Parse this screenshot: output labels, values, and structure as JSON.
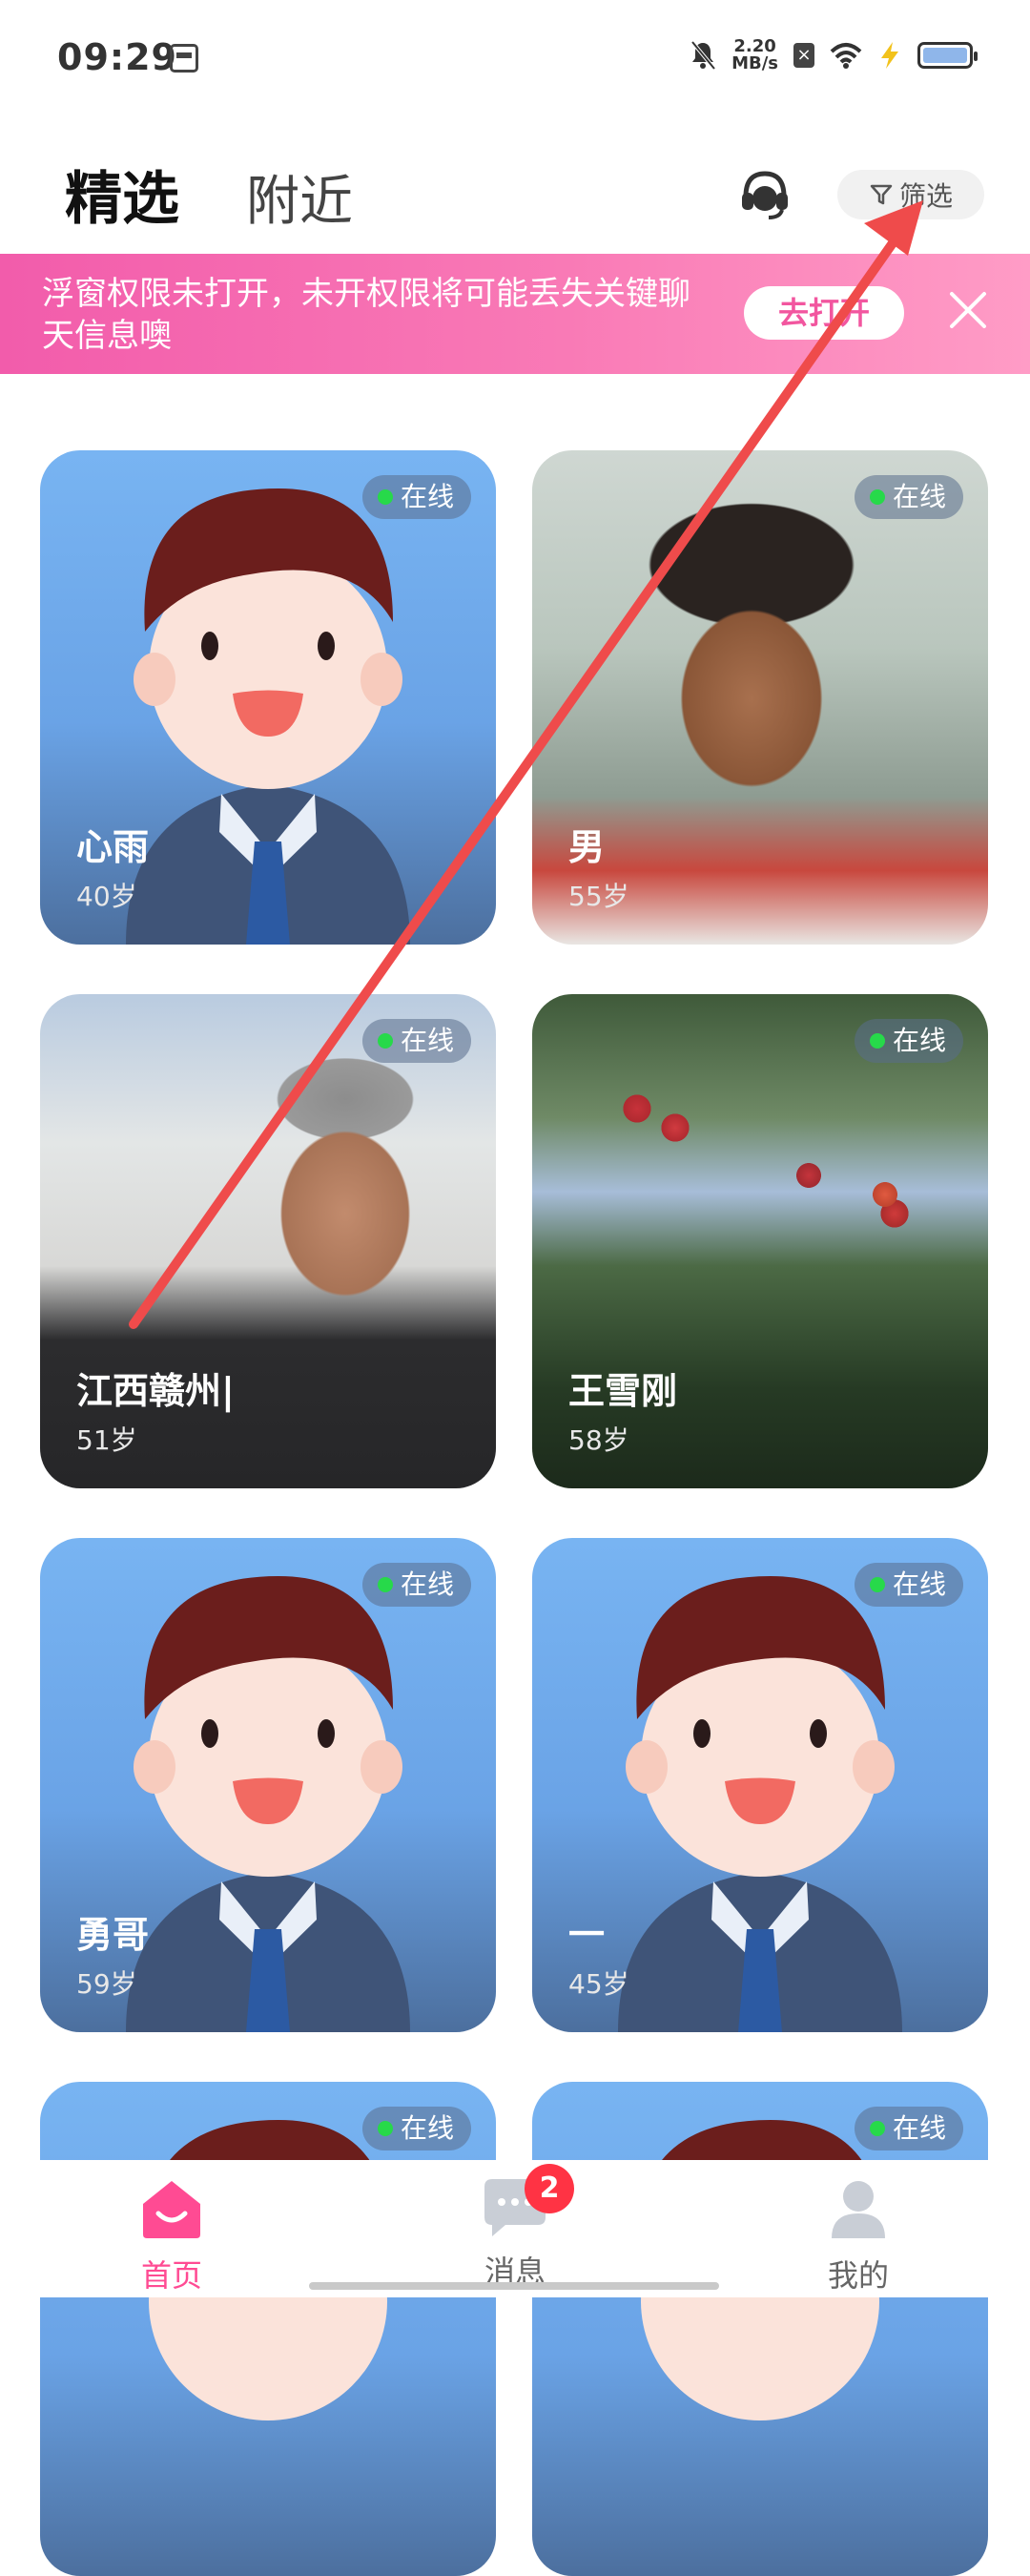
{
  "status_bar": {
    "time": "09:29",
    "speed": "2.20\nMB/s",
    "icons": [
      "image-icon",
      "mute-icon",
      "data-saver-icon",
      "wifi-icon",
      "charging-bolt-icon",
      "battery-icon"
    ]
  },
  "header": {
    "tabs": [
      {
        "label": "精选",
        "active": true
      },
      {
        "label": "附近",
        "active": false
      }
    ],
    "service_icon": "customer-service-icon",
    "filter_label": "筛选",
    "filter_icon": "filter-icon"
  },
  "banner": {
    "text": "浮窗权限未打开，未开权限将可能丢失关键聊天信息噢",
    "button_label": "去打开",
    "close_icon": "close-icon"
  },
  "profiles": [
    {
      "name": "心雨",
      "age": "40岁",
      "status": "在线",
      "image": "default-avatar"
    },
    {
      "name": "男",
      "age": "55岁",
      "status": "在线",
      "image": "photo-man"
    },
    {
      "name": "江西赣州|",
      "age": "51岁",
      "status": "在线",
      "image": "photo-man-building"
    },
    {
      "name": "王雪刚",
      "age": "58岁",
      "status": "在线",
      "image": "photo-cherries"
    },
    {
      "name": "勇哥",
      "age": "59岁",
      "status": "在线",
      "image": "default-avatar"
    },
    {
      "name": "一",
      "age": "45岁",
      "status": "在线",
      "image": "default-avatar"
    },
    {
      "name": "",
      "age": "",
      "status": "在线",
      "image": "default-avatar"
    },
    {
      "name": "",
      "age": "",
      "status": "在线",
      "image": "default-avatar"
    }
  ],
  "bottom_nav": [
    {
      "label": "首页",
      "icon": "home-icon",
      "active": true
    },
    {
      "label": "消息",
      "icon": "message-icon",
      "badge": "2",
      "active": false
    },
    {
      "label": "我的",
      "icon": "profile-icon",
      "active": false
    }
  ],
  "colors": {
    "accent": "#ff4b93",
    "banner_start": "#f25cab",
    "banner_end": "#ff9cc6",
    "online_dot": "#27d94a",
    "badge": "#ff3344"
  }
}
